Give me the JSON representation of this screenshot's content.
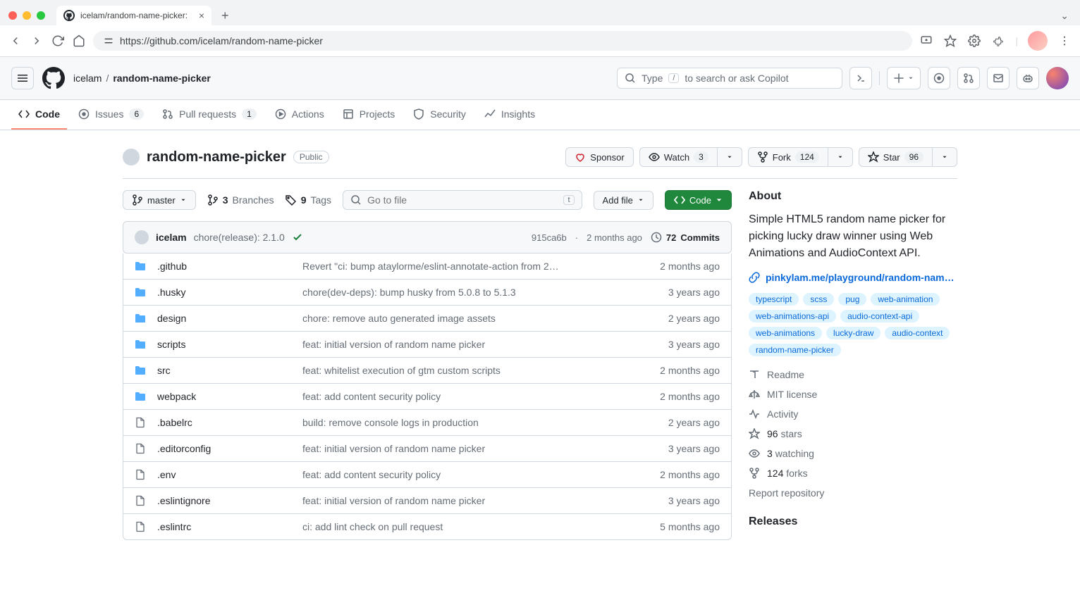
{
  "browser": {
    "tab_title": "icelam/random-name-picker:",
    "url_display": "https://github.com/icelam/random-name-picker"
  },
  "header": {
    "owner": "icelam",
    "repo": "random-name-picker",
    "search_placeholder": "Type",
    "search_suffix": "to search or ask Copilot",
    "slash_key": "/"
  },
  "repo_nav": {
    "code": "Code",
    "issues": "Issues",
    "issues_count": "6",
    "pulls": "Pull requests",
    "pulls_count": "1",
    "actions": "Actions",
    "projects": "Projects",
    "security": "Security",
    "insights": "Insights"
  },
  "title": {
    "repo": "random-name-picker",
    "visibility": "Public",
    "sponsor": "Sponsor",
    "watch": "Watch",
    "watch_count": "3",
    "fork": "Fork",
    "fork_count": "124",
    "star": "Star",
    "star_count": "96"
  },
  "controls": {
    "branch": "master",
    "branches_num": "3",
    "branches_label": "Branches",
    "tags_num": "9",
    "tags_label": "Tags",
    "go_to_file": "Go to file",
    "go_to_file_key": "t",
    "add_file": "Add file",
    "code": "Code"
  },
  "commit": {
    "author": "icelam",
    "message": "chore(release): 2.1.0",
    "sha": "915ca6b",
    "time": "2 months ago",
    "commits_num": "72",
    "commits_label": "Commits"
  },
  "files": [
    {
      "type": "dir",
      "name": ".github",
      "msg": "Revert \"ci: bump ataylorme/eslint-annotate-action from 2…",
      "date": "2 months ago"
    },
    {
      "type": "dir",
      "name": ".husky",
      "msg": "chore(dev-deps): bump husky from 5.0.8 to 5.1.3",
      "date": "3 years ago"
    },
    {
      "type": "dir",
      "name": "design",
      "msg": "chore: remove auto generated image assets",
      "date": "2 years ago"
    },
    {
      "type": "dir",
      "name": "scripts",
      "msg": "feat: initial version of random name picker",
      "date": "3 years ago"
    },
    {
      "type": "dir",
      "name": "src",
      "msg": "feat: whitelist execution of gtm custom scripts",
      "date": "2 months ago"
    },
    {
      "type": "dir",
      "name": "webpack",
      "msg": "feat: add content security policy",
      "date": "2 months ago"
    },
    {
      "type": "file",
      "name": ".babelrc",
      "msg": "build: remove console logs in production",
      "date": "2 years ago"
    },
    {
      "type": "file",
      "name": ".editorconfig",
      "msg": "feat: initial version of random name picker",
      "date": "3 years ago"
    },
    {
      "type": "file",
      "name": ".env",
      "msg": "feat: add content security policy",
      "date": "2 months ago"
    },
    {
      "type": "file",
      "name": ".eslintignore",
      "msg": "feat: initial version of random name picker",
      "date": "3 years ago"
    },
    {
      "type": "file",
      "name": ".eslintrc",
      "msg": "ci: add lint check on pull request",
      "date": "5 months ago"
    }
  ],
  "about": {
    "title": "About",
    "desc": "Simple HTML5 random name picker for picking lucky draw winner using Web Animations and AudioContext API.",
    "link": "pinkylam.me/playground/random-nam…",
    "topics": [
      "typescript",
      "scss",
      "pug",
      "web-animation",
      "web-animations-api",
      "audio-context-api",
      "web-animations",
      "lucky-draw",
      "audio-context",
      "random-name-picker"
    ],
    "readme": "Readme",
    "license": "MIT license",
    "activity": "Activity",
    "stars_num": "96",
    "stars_label": "stars",
    "watching_num": "3",
    "watching_label": "watching",
    "forks_num": "124",
    "forks_label": "forks",
    "report": "Report repository",
    "releases": "Releases"
  }
}
